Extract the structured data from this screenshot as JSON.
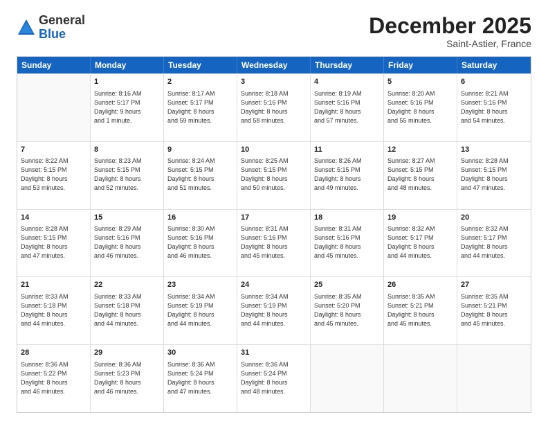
{
  "logo": {
    "general": "General",
    "blue": "Blue"
  },
  "header": {
    "title": "December 2025",
    "subtitle": "Saint-Astier, France"
  },
  "weekdays": [
    "Sunday",
    "Monday",
    "Tuesday",
    "Wednesday",
    "Thursday",
    "Friday",
    "Saturday"
  ],
  "weeks": [
    [
      {
        "day": "",
        "lines": []
      },
      {
        "day": "1",
        "lines": [
          "Sunrise: 8:16 AM",
          "Sunset: 5:17 PM",
          "Daylight: 9 hours",
          "and 1 minute."
        ]
      },
      {
        "day": "2",
        "lines": [
          "Sunrise: 8:17 AM",
          "Sunset: 5:17 PM",
          "Daylight: 8 hours",
          "and 59 minutes."
        ]
      },
      {
        "day": "3",
        "lines": [
          "Sunrise: 8:18 AM",
          "Sunset: 5:16 PM",
          "Daylight: 8 hours",
          "and 58 minutes."
        ]
      },
      {
        "day": "4",
        "lines": [
          "Sunrise: 8:19 AM",
          "Sunset: 5:16 PM",
          "Daylight: 8 hours",
          "and 57 minutes."
        ]
      },
      {
        "day": "5",
        "lines": [
          "Sunrise: 8:20 AM",
          "Sunset: 5:16 PM",
          "Daylight: 8 hours",
          "and 55 minutes."
        ]
      },
      {
        "day": "6",
        "lines": [
          "Sunrise: 8:21 AM",
          "Sunset: 5:16 PM",
          "Daylight: 8 hours",
          "and 54 minutes."
        ]
      }
    ],
    [
      {
        "day": "7",
        "lines": [
          "Sunrise: 8:22 AM",
          "Sunset: 5:15 PM",
          "Daylight: 8 hours",
          "and 53 minutes."
        ]
      },
      {
        "day": "8",
        "lines": [
          "Sunrise: 8:23 AM",
          "Sunset: 5:15 PM",
          "Daylight: 8 hours",
          "and 52 minutes."
        ]
      },
      {
        "day": "9",
        "lines": [
          "Sunrise: 8:24 AM",
          "Sunset: 5:15 PM",
          "Daylight: 8 hours",
          "and 51 minutes."
        ]
      },
      {
        "day": "10",
        "lines": [
          "Sunrise: 8:25 AM",
          "Sunset: 5:15 PM",
          "Daylight: 8 hours",
          "and 50 minutes."
        ]
      },
      {
        "day": "11",
        "lines": [
          "Sunrise: 8:26 AM",
          "Sunset: 5:15 PM",
          "Daylight: 8 hours",
          "and 49 minutes."
        ]
      },
      {
        "day": "12",
        "lines": [
          "Sunrise: 8:27 AM",
          "Sunset: 5:15 PM",
          "Daylight: 8 hours",
          "and 48 minutes."
        ]
      },
      {
        "day": "13",
        "lines": [
          "Sunrise: 8:28 AM",
          "Sunset: 5:15 PM",
          "Daylight: 8 hours",
          "and 47 minutes."
        ]
      }
    ],
    [
      {
        "day": "14",
        "lines": [
          "Sunrise: 8:28 AM",
          "Sunset: 5:15 PM",
          "Daylight: 8 hours",
          "and 47 minutes."
        ]
      },
      {
        "day": "15",
        "lines": [
          "Sunrise: 8:29 AM",
          "Sunset: 5:16 PM",
          "Daylight: 8 hours",
          "and 46 minutes."
        ]
      },
      {
        "day": "16",
        "lines": [
          "Sunrise: 8:30 AM",
          "Sunset: 5:16 PM",
          "Daylight: 8 hours",
          "and 46 minutes."
        ]
      },
      {
        "day": "17",
        "lines": [
          "Sunrise: 8:31 AM",
          "Sunset: 5:16 PM",
          "Daylight: 8 hours",
          "and 45 minutes."
        ]
      },
      {
        "day": "18",
        "lines": [
          "Sunrise: 8:31 AM",
          "Sunset: 5:16 PM",
          "Daylight: 8 hours",
          "and 45 minutes."
        ]
      },
      {
        "day": "19",
        "lines": [
          "Sunrise: 8:32 AM",
          "Sunset: 5:17 PM",
          "Daylight: 8 hours",
          "and 44 minutes."
        ]
      },
      {
        "day": "20",
        "lines": [
          "Sunrise: 8:32 AM",
          "Sunset: 5:17 PM",
          "Daylight: 8 hours",
          "and 44 minutes."
        ]
      }
    ],
    [
      {
        "day": "21",
        "lines": [
          "Sunrise: 8:33 AM",
          "Sunset: 5:18 PM",
          "Daylight: 8 hours",
          "and 44 minutes."
        ]
      },
      {
        "day": "22",
        "lines": [
          "Sunrise: 8:33 AM",
          "Sunset: 5:18 PM",
          "Daylight: 8 hours",
          "and 44 minutes."
        ]
      },
      {
        "day": "23",
        "lines": [
          "Sunrise: 8:34 AM",
          "Sunset: 5:19 PM",
          "Daylight: 8 hours",
          "and 44 minutes."
        ]
      },
      {
        "day": "24",
        "lines": [
          "Sunrise: 8:34 AM",
          "Sunset: 5:19 PM",
          "Daylight: 8 hours",
          "and 44 minutes."
        ]
      },
      {
        "day": "25",
        "lines": [
          "Sunrise: 8:35 AM",
          "Sunset: 5:20 PM",
          "Daylight: 8 hours",
          "and 45 minutes."
        ]
      },
      {
        "day": "26",
        "lines": [
          "Sunrise: 8:35 AM",
          "Sunset: 5:21 PM",
          "Daylight: 8 hours",
          "and 45 minutes."
        ]
      },
      {
        "day": "27",
        "lines": [
          "Sunrise: 8:35 AM",
          "Sunset: 5:21 PM",
          "Daylight: 8 hours",
          "and 45 minutes."
        ]
      }
    ],
    [
      {
        "day": "28",
        "lines": [
          "Sunrise: 8:36 AM",
          "Sunset: 5:22 PM",
          "Daylight: 8 hours",
          "and 46 minutes."
        ]
      },
      {
        "day": "29",
        "lines": [
          "Sunrise: 8:36 AM",
          "Sunset: 5:23 PM",
          "Daylight: 8 hours",
          "and 46 minutes."
        ]
      },
      {
        "day": "30",
        "lines": [
          "Sunrise: 8:36 AM",
          "Sunset: 5:24 PM",
          "Daylight: 8 hours",
          "and 47 minutes."
        ]
      },
      {
        "day": "31",
        "lines": [
          "Sunrise: 8:36 AM",
          "Sunset: 5:24 PM",
          "Daylight: 8 hours",
          "and 48 minutes."
        ]
      },
      {
        "day": "",
        "lines": []
      },
      {
        "day": "",
        "lines": []
      },
      {
        "day": "",
        "lines": []
      }
    ]
  ]
}
